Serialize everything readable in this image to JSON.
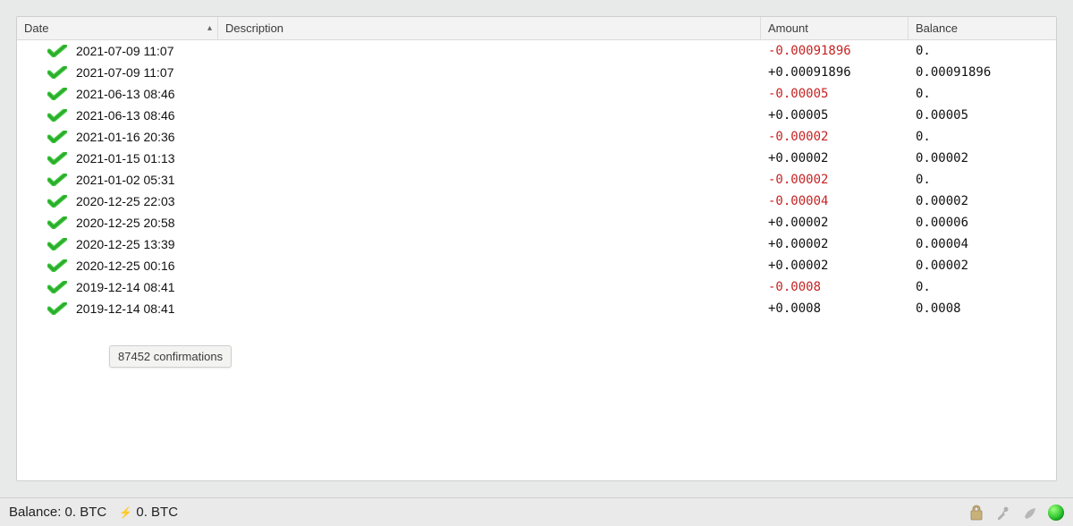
{
  "columns": {
    "date": "Date",
    "description": "Description",
    "amount": "Amount",
    "balance": "Balance"
  },
  "transactions": [
    {
      "date": "2021-07-09 11:07",
      "description": "",
      "amount": "-0.00091896",
      "amount_neg": true,
      "balance": "0."
    },
    {
      "date": "2021-07-09 11:07",
      "description": "",
      "amount": "+0.00091896",
      "amount_neg": false,
      "balance": "0.00091896"
    },
    {
      "date": "2021-06-13 08:46",
      "description": "",
      "amount": "-0.00005",
      "amount_neg": true,
      "balance": "0."
    },
    {
      "date": "2021-06-13 08:46",
      "description": "",
      "amount": "+0.00005",
      "amount_neg": false,
      "balance": "0.00005"
    },
    {
      "date": "2021-01-16 20:36",
      "description": "",
      "amount": "-0.00002",
      "amount_neg": true,
      "balance": "0."
    },
    {
      "date": "2021-01-15 01:13",
      "description": "",
      "amount": "+0.00002",
      "amount_neg": false,
      "balance": "0.00002"
    },
    {
      "date": "2021-01-02 05:31",
      "description": "",
      "amount": "-0.00002",
      "amount_neg": true,
      "balance": "0."
    },
    {
      "date": "2020-12-25 22:03",
      "description": "",
      "amount": "-0.00004",
      "amount_neg": true,
      "balance": "0.00002"
    },
    {
      "date": "2020-12-25 20:58",
      "description": "",
      "amount": "+0.00002",
      "amount_neg": false,
      "balance": "0.00006"
    },
    {
      "date": "2020-12-25 13:39",
      "description": "",
      "amount": "+0.00002",
      "amount_neg": false,
      "balance": "0.00004"
    },
    {
      "date": "2020-12-25 00:16",
      "description": "",
      "amount": "+0.00002",
      "amount_neg": false,
      "balance": "0.00002"
    },
    {
      "date": "2019-12-14 08:41",
      "description": "",
      "amount": "-0.0008",
      "amount_neg": true,
      "balance": "0."
    },
    {
      "date": "2019-12-14 08:41",
      "description": "",
      "amount": "+0.0008",
      "amount_neg": false,
      "balance": "0.0008"
    }
  ],
  "tooltip": "87452 confirmations",
  "status": {
    "balance_label": "Balance:",
    "balance_value": "0. BTC",
    "lightning_value": "0. BTC"
  },
  "icons": {
    "confirmed": "confirmed-check-icon",
    "lock": "lock-icon",
    "tools": "tools-icon",
    "seed": "seed-icon",
    "network": "network-status-dot"
  },
  "colors": {
    "negative": "#c62323",
    "positive": "#111111",
    "status_green": "#25c028"
  }
}
